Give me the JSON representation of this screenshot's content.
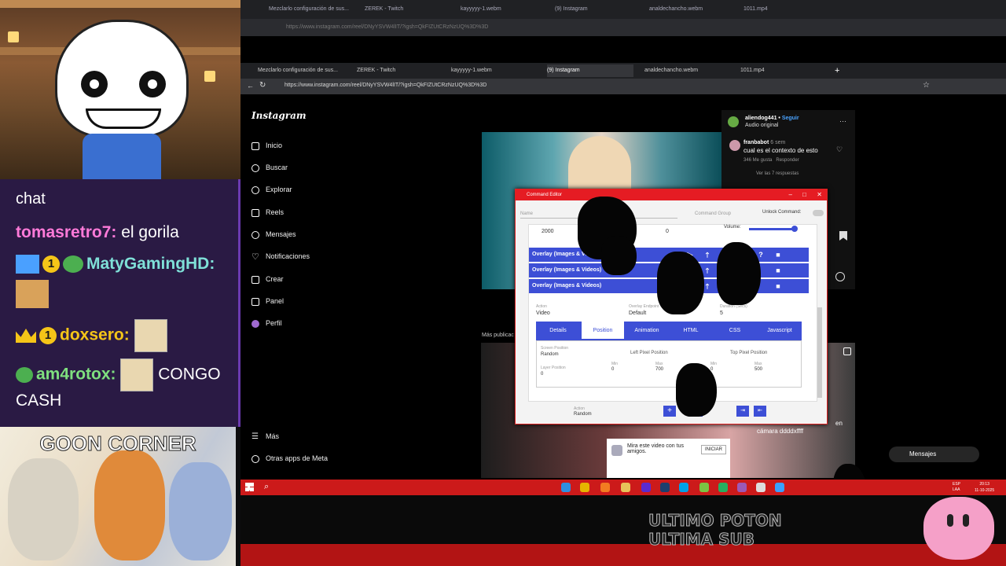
{
  "stream": {
    "chat_title": "chat",
    "messages": [
      {
        "user": "tomasretro7:",
        "text": "el gorila",
        "color": "#ff7ad9"
      },
      {
        "user": "MatyGamingHD:",
        "text": "",
        "color": "#7fe0d8",
        "badge": "1"
      },
      {
        "user": "doxsero:",
        "text": "",
        "color": "#f5c518",
        "badge": "1"
      },
      {
        "user": "am4rotox:",
        "text": "CONGO",
        "text2": "CASH",
        "color": "#7fe07f"
      }
    ],
    "goon_title": "GOON CORNER",
    "banner_lines": [
      "ULTIMO POTON",
      "ULTIMA SUB"
    ]
  },
  "browser": {
    "tabs": [
      "Mezclarlo configuración de sus...",
      "ZEREK - Twitch",
      "kayyyyy-1.webm",
      "(9) Instagram",
      "analdechancho.webm",
      "1011.mp4"
    ],
    "url": "https://www.instagram.com/reel/DNyYSVW4lIT/?igsh=QkFIZUtCRzNzUQ%3D%3D"
  },
  "instagram": {
    "logo": "Instagram",
    "nav": [
      {
        "label": "Inicio",
        "icon": "home-icon"
      },
      {
        "label": "Buscar",
        "icon": "search-icon"
      },
      {
        "label": "Explorar",
        "icon": "compass-icon"
      },
      {
        "label": "Reels",
        "icon": "reels-icon"
      },
      {
        "label": "Mensajes",
        "icon": "messenger-icon"
      },
      {
        "label": "Notificaciones",
        "icon": "heart-icon"
      },
      {
        "label": "Crear",
        "icon": "plus-icon"
      },
      {
        "label": "Panel",
        "icon": "chart-icon"
      },
      {
        "label": "Perfil",
        "icon": "profile-icon"
      }
    ],
    "more": "Más",
    "meta": "Otras apps de Meta",
    "post_user": "aliendog441",
    "follow": "Seguir",
    "audio": "Audio original",
    "comment_user": "franbabot",
    "comment_time": "6 sem",
    "comment_text": "cual es el contexto de esto",
    "comment_likes": "346 Me gusta",
    "reply": "Responder",
    "view_replies": "Ver las 7 respuestas",
    "more_posts": "Más publicac",
    "caption": "cámara ddddxffff",
    "caption_prefix": "en",
    "popup_text": "Mira este video con tus amigos.",
    "popup_button": "INICIAR",
    "messages_pill": "Mensajes"
  },
  "editor": {
    "title": "Command Editor",
    "name_label": "Name",
    "group_label": "Command Group",
    "unlock_label": "Unlock Command:",
    "duration_value": "2000",
    "field2_value": "0",
    "volume_label": "Volume:",
    "rows": [
      "Overlay (Images & Vide",
      "Overlay (Images & Videos)",
      "Overlay (Images & Videos)"
    ],
    "action_label": "Action",
    "action_value": "Video",
    "display_label": "Overlay Endpoint",
    "display_value": "Default",
    "duration_label": "Duration (Secs)",
    "duration_secs": "5",
    "tabs": [
      "Details",
      "Position",
      "Animation",
      "HTML",
      "CSS",
      "Javascript"
    ],
    "screen_pos_label": "Screen Position",
    "screen_pos_value": "Random",
    "layer_label": "Layer Position",
    "layer_value": "0",
    "left_pixel": "Left Pixel Position",
    "top_pixel": "Top Pixel Position",
    "min_label": "Min",
    "max_label": "Max",
    "left_min": "0",
    "left_max": "700",
    "top_min": "0",
    "top_max": "500",
    "bottom_action_label": "Action",
    "bottom_action_value": "Random"
  },
  "taskbar": {
    "lang": "ESP\nLAA",
    "time": "20:13",
    "date": "11-10-2025"
  }
}
